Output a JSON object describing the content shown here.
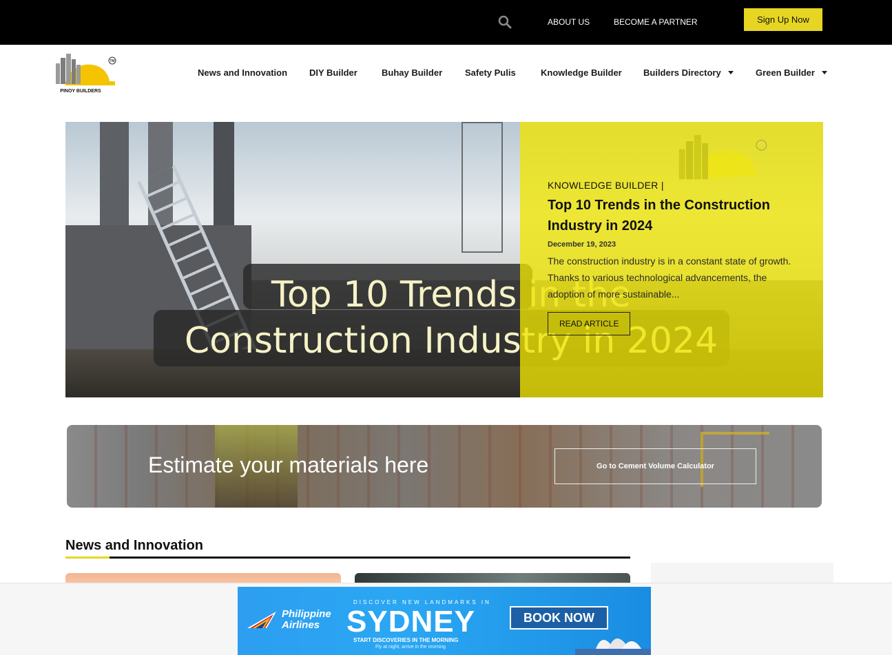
{
  "topbar": {
    "search_icon": "search-icon",
    "about_label": "ABOUT US",
    "partner_label": "BECOME A PARTNER",
    "signup_label": "Sign Up Now",
    "accent_color": "#e7d524"
  },
  "logo": {
    "text": "PINOY BUILDERS",
    "tm": "TM"
  },
  "nav": {
    "items": [
      {
        "label": "News and Innovation",
        "dropdown": false
      },
      {
        "label": "DIY Builder",
        "dropdown": false
      },
      {
        "label": "Buhay Builder",
        "dropdown": false
      },
      {
        "label": "Safety Pulis",
        "dropdown": false
      },
      {
        "label": "Knowledge Builder",
        "dropdown": false
      },
      {
        "label": "Builders Directory",
        "dropdown": true
      },
      {
        "label": "Green Builder",
        "dropdown": true
      }
    ]
  },
  "hero": {
    "image_title_line1": "Top 10 Trends in the",
    "image_title_line2": "Construction Industry in 2024",
    "category": "KNOWLEDGE BUILDER |",
    "title": "Top 10 Trends in the Construction Industry in 2024",
    "date": "December 19, 2023",
    "excerpt": "The construction industry is in a constant state of growth. Thanks to various technological advancements, the adoption of more sustainable...",
    "read_label": "READ ARTICLE",
    "overlay_color": "#eee400"
  },
  "estimate": {
    "text": "Estimate your materials here",
    "button_label": "Go to Cement Volume Calculator"
  },
  "section": {
    "title": "News and Innovation"
  },
  "ad": {
    "brand_line1": "Philippine",
    "brand_line2": "Airlines",
    "tagline": "DISCOVER NEW LANDMARKS IN",
    "city": "SYDNEY",
    "sub1": "START DISCOVERIES IN THE MORNING",
    "sub2": "Fly at night, arrive in the morning",
    "book_label": "BOOK NOW"
  }
}
